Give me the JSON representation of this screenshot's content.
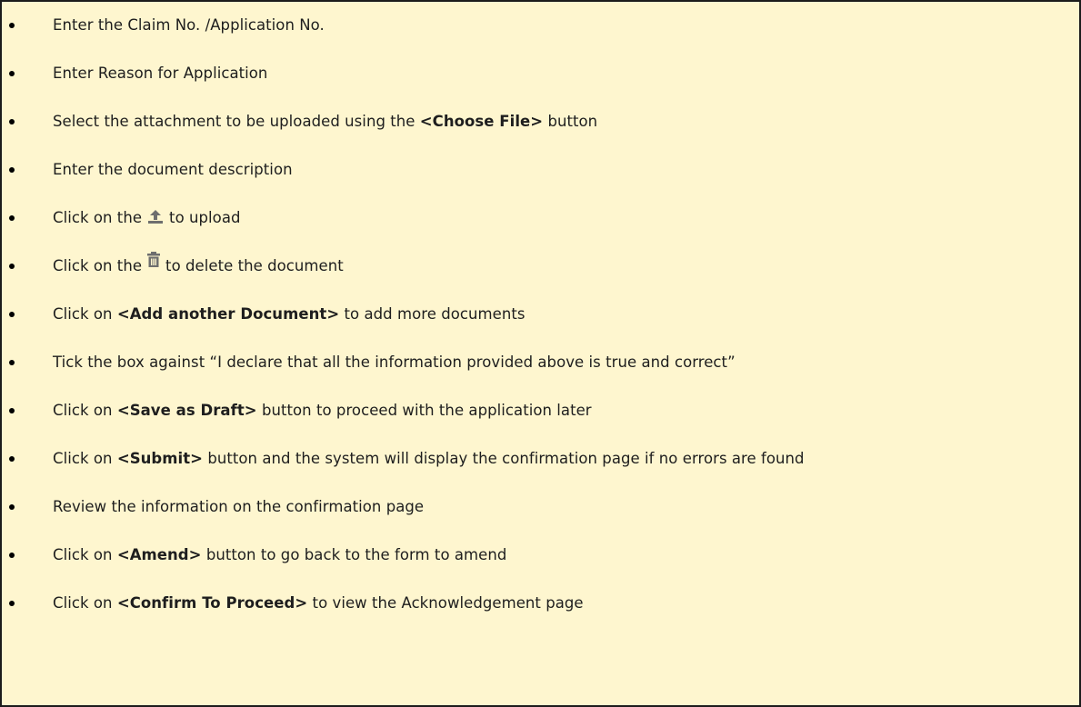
{
  "steps": [
    {
      "text": "Enter the Claim No. /Application No."
    },
    {
      "text": "Enter Reason for Application"
    },
    {
      "before": "Select the attachment to be uploaded using the ",
      "bold": "<Choose File>",
      "after": " button"
    },
    {
      "text": "Enter the document description"
    },
    {
      "before": "Click on the",
      "icon": "upload-icon",
      "after": "to upload"
    },
    {
      "before": "Click on the",
      "icon": "trash-icon",
      "after": "to delete the document"
    },
    {
      "before": "Click on ",
      "bold": "<Add another Document>",
      "after": " to add more documents"
    },
    {
      "text": "Tick the box against “I declare that all the information provided above is true and correct”"
    },
    {
      "before": "Click on ",
      "bold": "<Save as Draft>",
      "after": " button to proceed with the application later"
    },
    {
      "before": "Click on ",
      "bold": "<Submit>",
      "after": " button and the system will display the confirmation page if no errors are found"
    },
    {
      "text": "Review the information on the confirmation page"
    },
    {
      "before": "Click on ",
      "bold": "<Amend>",
      "after": " button to go back to the form to amend"
    },
    {
      "before": "Click on ",
      "bold": "<Confirm To Proceed>",
      "after": " to view the Acknowledgement page"
    }
  ],
  "colors": {
    "background": "#fef6cf",
    "border": "#1c1c1c",
    "text": "#1e1e1e",
    "icon": "#6e6e6e"
  }
}
